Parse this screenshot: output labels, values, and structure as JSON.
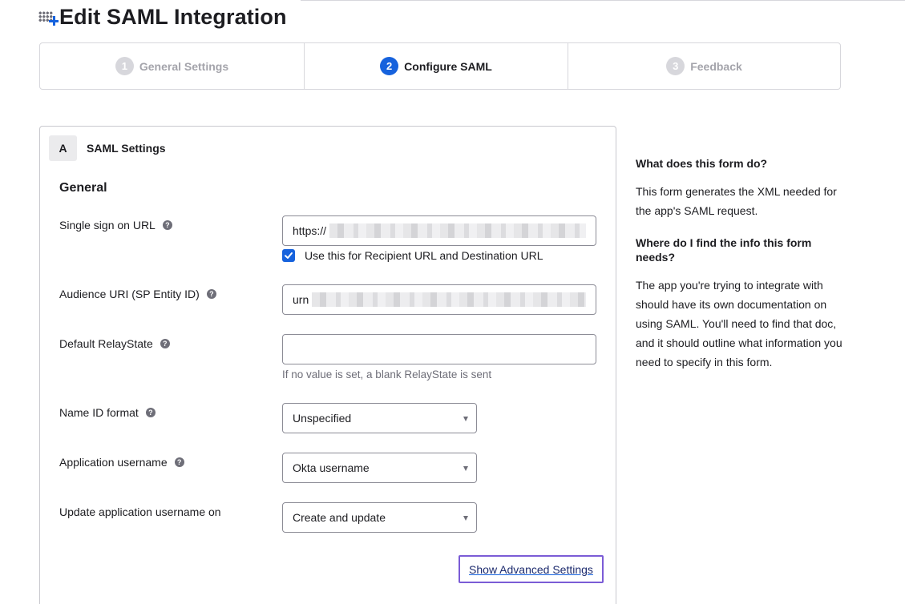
{
  "page": {
    "title": "Edit SAML Integration"
  },
  "steps": [
    {
      "number": "1",
      "label": "General Settings",
      "state": "done"
    },
    {
      "number": "2",
      "label": "Configure SAML",
      "state": "active"
    },
    {
      "number": "3",
      "label": "Feedback",
      "state": "upcoming"
    }
  ],
  "section": {
    "letter": "A",
    "title": "SAML Settings",
    "group_title": "General"
  },
  "fields": {
    "sso_url": {
      "label": "Single sign on URL",
      "value_prefix": "https://",
      "help": "?"
    },
    "recipient_checkbox": {
      "label": "Use this for Recipient URL and Destination URL",
      "checked": true
    },
    "audience_uri": {
      "label": "Audience URI (SP Entity ID)",
      "value_prefix": "urn",
      "help": "?"
    },
    "relay_state": {
      "label": "Default RelayState",
      "value": "",
      "hint": "If no value is set, a blank RelayState is sent",
      "help": "?"
    },
    "name_id_format": {
      "label": "Name ID format",
      "value": "Unspecified",
      "help": "?"
    },
    "app_username": {
      "label": "Application username",
      "value": "Okta username",
      "help": "?"
    },
    "update_username_on": {
      "label": "Update application username on",
      "value": "Create and update"
    }
  },
  "advanced_link": "Show Advanced Settings",
  "sidebar": {
    "q1": "What does this form do?",
    "a1": "This form generates the XML needed for the app's SAML request.",
    "q2": "Where do I find the info this form needs?",
    "a2": "The app you're trying to integrate with should have its own documentation on using SAML. You'll need to find that doc, and it should outline what information you need to specify in this form."
  },
  "colors": {
    "accent": "#1662dd",
    "focus_ring": "#7b5cd6",
    "muted": "#a4a4ab",
    "border": "#d7d7dc"
  }
}
